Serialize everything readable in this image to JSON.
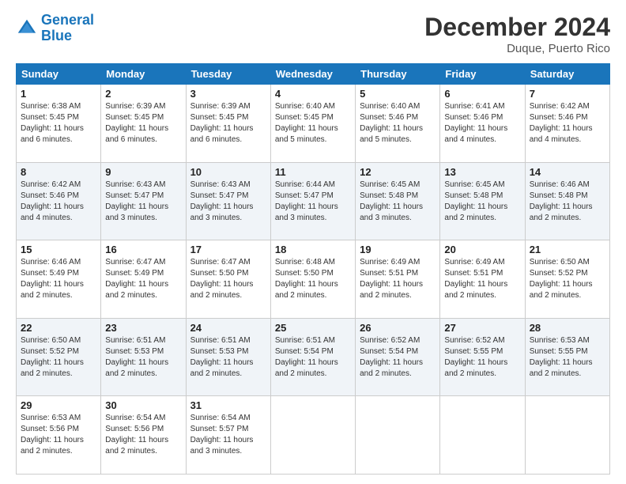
{
  "header": {
    "logo_line1": "General",
    "logo_line2": "Blue",
    "title": "December 2024",
    "subtitle": "Duque, Puerto Rico"
  },
  "days_of_week": [
    "Sunday",
    "Monday",
    "Tuesday",
    "Wednesday",
    "Thursday",
    "Friday",
    "Saturday"
  ],
  "weeks": [
    [
      {
        "day": 1,
        "detail": "Sunrise: 6:38 AM\nSunset: 5:45 PM\nDaylight: 11 hours\nand 6 minutes."
      },
      {
        "day": 2,
        "detail": "Sunrise: 6:39 AM\nSunset: 5:45 PM\nDaylight: 11 hours\nand 6 minutes."
      },
      {
        "day": 3,
        "detail": "Sunrise: 6:39 AM\nSunset: 5:45 PM\nDaylight: 11 hours\nand 6 minutes."
      },
      {
        "day": 4,
        "detail": "Sunrise: 6:40 AM\nSunset: 5:45 PM\nDaylight: 11 hours\nand 5 minutes."
      },
      {
        "day": 5,
        "detail": "Sunrise: 6:40 AM\nSunset: 5:46 PM\nDaylight: 11 hours\nand 5 minutes."
      },
      {
        "day": 6,
        "detail": "Sunrise: 6:41 AM\nSunset: 5:46 PM\nDaylight: 11 hours\nand 4 minutes."
      },
      {
        "day": 7,
        "detail": "Sunrise: 6:42 AM\nSunset: 5:46 PM\nDaylight: 11 hours\nand 4 minutes."
      }
    ],
    [
      {
        "day": 8,
        "detail": "Sunrise: 6:42 AM\nSunset: 5:46 PM\nDaylight: 11 hours\nand 4 minutes."
      },
      {
        "day": 9,
        "detail": "Sunrise: 6:43 AM\nSunset: 5:47 PM\nDaylight: 11 hours\nand 3 minutes."
      },
      {
        "day": 10,
        "detail": "Sunrise: 6:43 AM\nSunset: 5:47 PM\nDaylight: 11 hours\nand 3 minutes."
      },
      {
        "day": 11,
        "detail": "Sunrise: 6:44 AM\nSunset: 5:47 PM\nDaylight: 11 hours\nand 3 minutes."
      },
      {
        "day": 12,
        "detail": "Sunrise: 6:45 AM\nSunset: 5:48 PM\nDaylight: 11 hours\nand 3 minutes."
      },
      {
        "day": 13,
        "detail": "Sunrise: 6:45 AM\nSunset: 5:48 PM\nDaylight: 11 hours\nand 2 minutes."
      },
      {
        "day": 14,
        "detail": "Sunrise: 6:46 AM\nSunset: 5:48 PM\nDaylight: 11 hours\nand 2 minutes."
      }
    ],
    [
      {
        "day": 15,
        "detail": "Sunrise: 6:46 AM\nSunset: 5:49 PM\nDaylight: 11 hours\nand 2 minutes."
      },
      {
        "day": 16,
        "detail": "Sunrise: 6:47 AM\nSunset: 5:49 PM\nDaylight: 11 hours\nand 2 minutes."
      },
      {
        "day": 17,
        "detail": "Sunrise: 6:47 AM\nSunset: 5:50 PM\nDaylight: 11 hours\nand 2 minutes."
      },
      {
        "day": 18,
        "detail": "Sunrise: 6:48 AM\nSunset: 5:50 PM\nDaylight: 11 hours\nand 2 minutes."
      },
      {
        "day": 19,
        "detail": "Sunrise: 6:49 AM\nSunset: 5:51 PM\nDaylight: 11 hours\nand 2 minutes."
      },
      {
        "day": 20,
        "detail": "Sunrise: 6:49 AM\nSunset: 5:51 PM\nDaylight: 11 hours\nand 2 minutes."
      },
      {
        "day": 21,
        "detail": "Sunrise: 6:50 AM\nSunset: 5:52 PM\nDaylight: 11 hours\nand 2 minutes."
      }
    ],
    [
      {
        "day": 22,
        "detail": "Sunrise: 6:50 AM\nSunset: 5:52 PM\nDaylight: 11 hours\nand 2 minutes."
      },
      {
        "day": 23,
        "detail": "Sunrise: 6:51 AM\nSunset: 5:53 PM\nDaylight: 11 hours\nand 2 minutes."
      },
      {
        "day": 24,
        "detail": "Sunrise: 6:51 AM\nSunset: 5:53 PM\nDaylight: 11 hours\nand 2 minutes."
      },
      {
        "day": 25,
        "detail": "Sunrise: 6:51 AM\nSunset: 5:54 PM\nDaylight: 11 hours\nand 2 minutes."
      },
      {
        "day": 26,
        "detail": "Sunrise: 6:52 AM\nSunset: 5:54 PM\nDaylight: 11 hours\nand 2 minutes."
      },
      {
        "day": 27,
        "detail": "Sunrise: 6:52 AM\nSunset: 5:55 PM\nDaylight: 11 hours\nand 2 minutes."
      },
      {
        "day": 28,
        "detail": "Sunrise: 6:53 AM\nSunset: 5:55 PM\nDaylight: 11 hours\nand 2 minutes."
      }
    ],
    [
      {
        "day": 29,
        "detail": "Sunrise: 6:53 AM\nSunset: 5:56 PM\nDaylight: 11 hours\nand 2 minutes."
      },
      {
        "day": 30,
        "detail": "Sunrise: 6:54 AM\nSunset: 5:56 PM\nDaylight: 11 hours\nand 2 minutes."
      },
      {
        "day": 31,
        "detail": "Sunrise: 6:54 AM\nSunset: 5:57 PM\nDaylight: 11 hours\nand 3 minutes."
      },
      null,
      null,
      null,
      null
    ]
  ]
}
